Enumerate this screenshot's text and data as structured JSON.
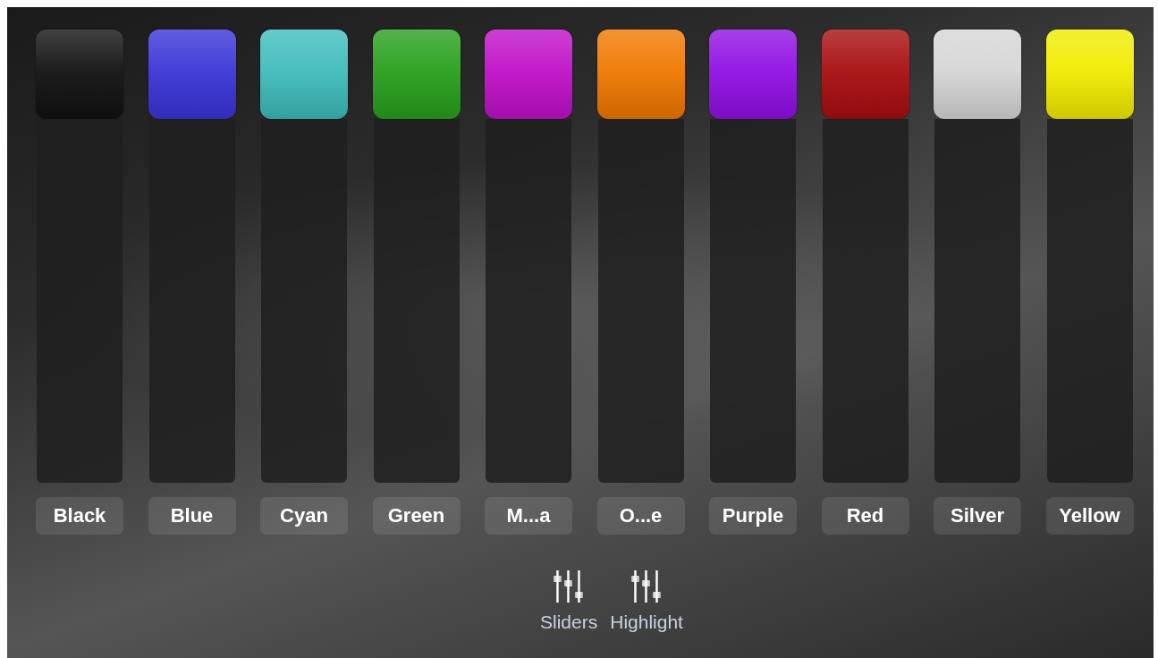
{
  "colors": [
    {
      "label": "Black",
      "color": "#111111"
    },
    {
      "label": "Blue",
      "color": "#3a35d8"
    },
    {
      "label": "Cyan",
      "color": "#3fbcbc"
    },
    {
      "label": "Green",
      "color": "#28a01c"
    },
    {
      "label": "M...a",
      "color": "#c010c8"
    },
    {
      "label": "O...e",
      "color": "#f07800"
    },
    {
      "label": "Purple",
      "color": "#9010e4"
    },
    {
      "label": "Red",
      "color": "#a80e10"
    },
    {
      "label": "Silver",
      "color": "#d6d6d6"
    },
    {
      "label": "Yellow",
      "color": "#f2ec00"
    }
  ],
  "toolbar": [
    {
      "label": "Sliders"
    },
    {
      "label": "Highlight"
    }
  ]
}
